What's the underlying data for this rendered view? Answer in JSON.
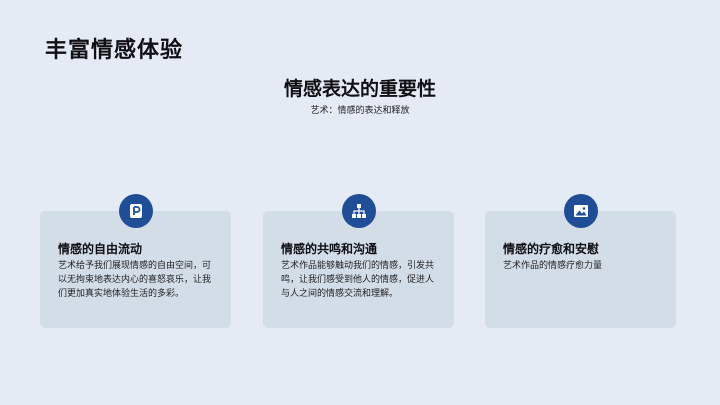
{
  "slide": {
    "title": "丰富情感体验",
    "section_title": "情感表达的重要性",
    "section_subtitle": "艺术：情感的表达和释放"
  },
  "cards": [
    {
      "icon": "parking-sign-icon",
      "title": "情感的自由流动",
      "body": "艺术给予我们展现情感的自由空间，可以无拘束地表达内心的喜怒哀乐，让我们更加真实地体验生活的多彩。"
    },
    {
      "icon": "hierarchy-icon",
      "title": "情感的共鸣和沟通",
      "body": "艺术作品能够触动我们的情感，引发共鸣，让我们感受到他人的情感，促进人与人之间的情感交流和理解。"
    },
    {
      "icon": "image-icon",
      "title": "情感的疗愈和安慰",
      "body": "艺术作品的情感疗愈力量"
    }
  ],
  "colors": {
    "background": "#e4ebf4",
    "card": "#d3dde8",
    "icon_circle": "#1f4d96"
  }
}
